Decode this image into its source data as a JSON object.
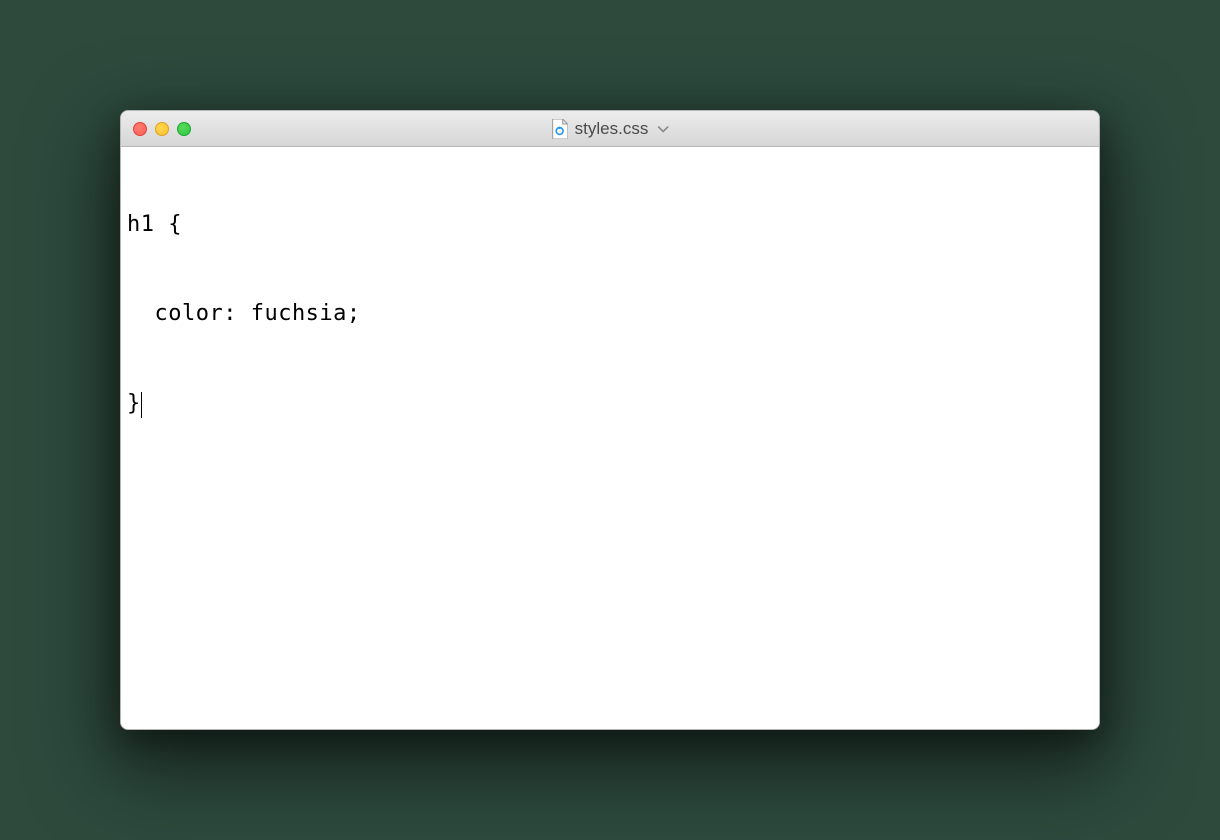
{
  "window": {
    "title": "styles.css",
    "file_icon": "css-file-icon"
  },
  "traffic_lights": {
    "close": "close",
    "minimize": "minimize",
    "zoom": "zoom"
  },
  "editor": {
    "lines": [
      "h1 {",
      "  color: fuchsia;",
      "}"
    ],
    "line1": "h1 {",
    "line2": "  color: fuchsia;",
    "line3": "}"
  }
}
